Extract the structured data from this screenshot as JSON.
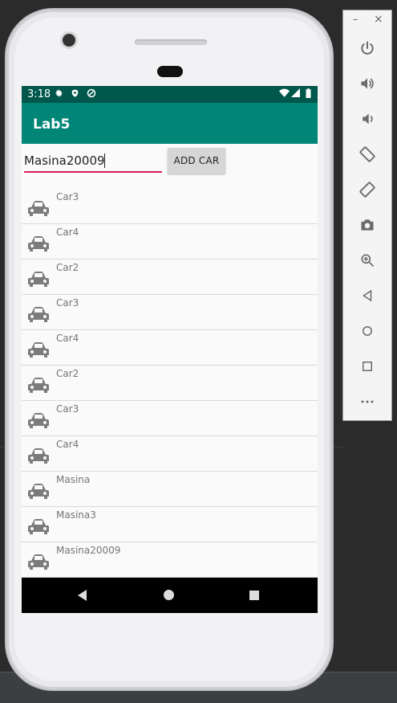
{
  "app": {
    "title": "Lab5"
  },
  "status_bar": {
    "time": "3:18"
  },
  "input": {
    "value": "Masina20009"
  },
  "add_button": {
    "label": "ADD CAR"
  },
  "cars": [
    "Car3",
    "Car4",
    "Car2",
    "Car3",
    "Car4",
    "Car2",
    "Car3",
    "Car4",
    "Masina",
    "Masina3",
    "Masina20009"
  ],
  "colors": {
    "status_bar": "#00574b",
    "app_bar": "#008577",
    "accent": "#d81b60",
    "car_icon": "#7b7b7b"
  },
  "toolbar": {
    "minimize": "–",
    "close": "×",
    "icons": [
      "power-icon",
      "volume-up-icon",
      "volume-down-icon",
      "rotate-left-icon",
      "rotate-right-icon",
      "camera-icon",
      "zoom-icon",
      "back-icon",
      "home-icon",
      "overview-icon",
      "more-icon"
    ]
  }
}
